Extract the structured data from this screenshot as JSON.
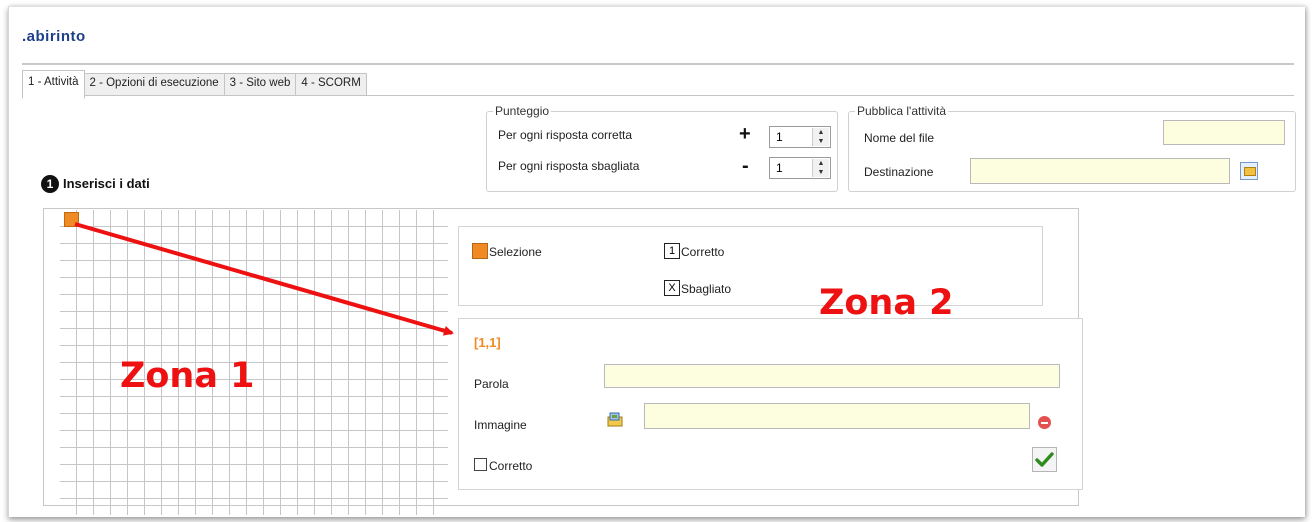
{
  "app": {
    "title": ".abirinto"
  },
  "tabs": [
    {
      "label": "1 - Attività",
      "active": true
    },
    {
      "label": "2 - Opzioni di esecuzione",
      "active": false
    },
    {
      "label": "3 - Sito web",
      "active": false
    },
    {
      "label": "4 - SCORM",
      "active": false
    }
  ],
  "punteggio": {
    "legend": "Punteggio",
    "correct_label": "Per ogni risposta corretta",
    "correct_sign": "+",
    "correct_value": "1",
    "wrong_label": "Per ogni risposta sbagliata",
    "wrong_sign": "-",
    "wrong_value": "1"
  },
  "pubblica": {
    "legend": "Pubblica l'attività",
    "filename_label": "Nome del file",
    "filename_value": "",
    "destination_label": "Destinazione",
    "destination_value": ""
  },
  "step": {
    "number": "1",
    "label": "Inserisci i dati"
  },
  "legend": {
    "selection": "Selezione",
    "correct_box": "1",
    "correct": "Corretto",
    "wrong_box": "X",
    "wrong": "Sbagliato"
  },
  "editor": {
    "coordinate": "[1,1]",
    "word_label": "Parola",
    "word_value": "",
    "image_label": "Immagine",
    "image_value": "",
    "correct_label": "Corretto",
    "correct_checked": false
  },
  "annotations": {
    "zone1": "Zona 1",
    "zone2": "Zona 2"
  },
  "colors": {
    "accent": "#f08a24",
    "annotation": "#ee1111",
    "input_bg": "#fdfde0",
    "title": "#1e3f8a"
  },
  "icons": {
    "browse": "folder-browse-icon",
    "image": "image-folder-icon",
    "remove": "remove-icon",
    "confirm": "checkmark-icon"
  }
}
